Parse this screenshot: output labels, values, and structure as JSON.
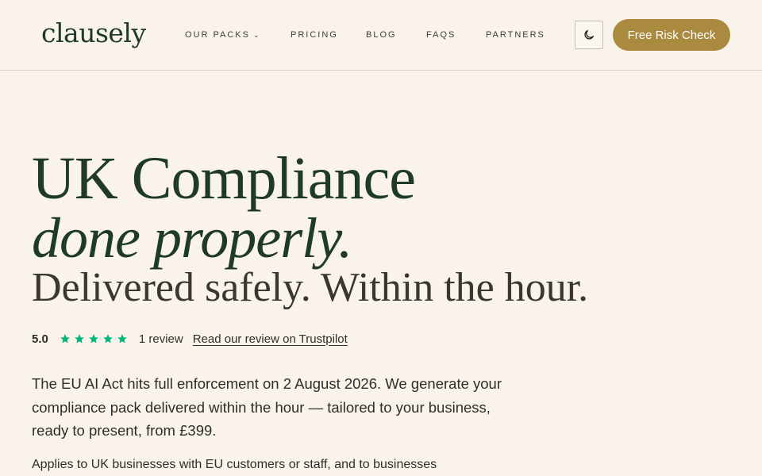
{
  "header": {
    "logo": "clausely",
    "nav": [
      {
        "label": "OUR PACKS",
        "has_dropdown": true
      },
      {
        "label": "PRICING"
      },
      {
        "label": "BLOG"
      },
      {
        "label": "FAQS"
      },
      {
        "label": "PARTNERS"
      }
    ],
    "theme_toggle_icon": "moon-icon",
    "cta_label": "Free Risk Check"
  },
  "hero": {
    "title_line1": "UK Compliance",
    "title_line2": "done properly.",
    "title_line3": "Delivered safely. Within the hour.",
    "rating": {
      "score": "5.0",
      "stars": 5,
      "review_count": "1 review",
      "link_text": "Read our review on Trustpilot"
    },
    "lead": "The EU AI Act hits full enforcement on 2 August 2026. We generate your compliance pack delivered within the hour — tailored to your business, ready to present, from £399.",
    "sub": "Applies to UK businesses with EU customers or staff, and to businesses"
  },
  "colors": {
    "background": "#faf3e9",
    "brand_green": "#1f3a27",
    "cta_gold": "#a98a3f",
    "star_green": "#00b67a"
  }
}
